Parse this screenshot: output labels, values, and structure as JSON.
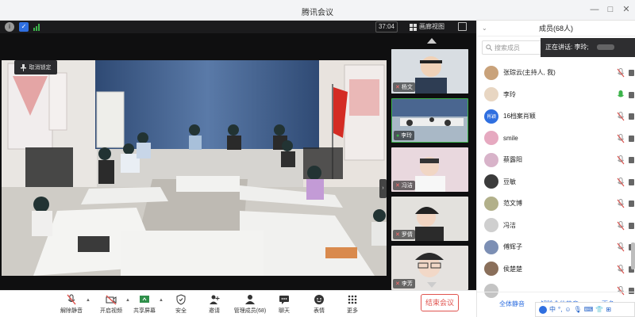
{
  "window": {
    "title": "腾讯会议"
  },
  "meeting": {
    "timer": "37:04",
    "view_label": "画廊视图",
    "cancel_lock_label": "取消锁定"
  },
  "thumbnails": [
    {
      "name": "杨文",
      "muted": true
    },
    {
      "name": "李玲",
      "muted": false
    },
    {
      "name": "冯洁",
      "muted": true
    },
    {
      "name": "罗倩",
      "muted": true
    },
    {
      "name": "李芳",
      "muted": true
    }
  ],
  "toolbar": {
    "items": [
      "解除静音",
      "开启视频",
      "共享屏幕",
      "安全",
      "邀请",
      "管理成员(68)",
      "聊天",
      "表情",
      "更多"
    ],
    "end_label": "结束会议"
  },
  "panel": {
    "title": "成员(68人)",
    "search_placeholder": "搜索成员",
    "speaking": "正在讲话: 李玲;",
    "members": [
      {
        "name": "张琮云(主持人, 我)",
        "avatar_color": "#c9a27a",
        "mic": "muted"
      },
      {
        "name": "李玲",
        "avatar_color": "#e8d6c2",
        "mic": "active"
      },
      {
        "name": "16档案肖颖",
        "avatar_color": "#2f6fe0",
        "avatar_text": "肖颖",
        "mic": "muted"
      },
      {
        "name": "smile",
        "avatar_color": "#e6a9c0",
        "mic": "muted"
      },
      {
        "name": "蔡露阳",
        "avatar_color": "#d8b3c9",
        "mic": "muted"
      },
      {
        "name": "豆敏",
        "avatar_color": "#3b3b3b",
        "mic": "muted"
      },
      {
        "name": "范文博",
        "avatar_color": "#b2b08a",
        "mic": "muted"
      },
      {
        "name": "冯洁",
        "avatar_color": "#cfcfcf",
        "mic": "muted"
      },
      {
        "name": "傅辉子",
        "avatar_color": "#7c8fb4",
        "mic": "muted"
      },
      {
        "name": "侯楚楚",
        "avatar_color": "#8a6f5a",
        "mic": "muted"
      },
      {
        "name": "",
        "avatar_color": "#c4c4c4",
        "mic": "muted"
      }
    ],
    "mute_all_label": "全体静音",
    "unmute_all_label": "解除全体静音",
    "more_label": "更多"
  },
  "ime": {
    "label": "中"
  },
  "colors": {
    "accent": "#2f6fe0",
    "end": "#e0544f",
    "muted_mic": "#d9534f",
    "active_mic": "#3cb34a"
  }
}
